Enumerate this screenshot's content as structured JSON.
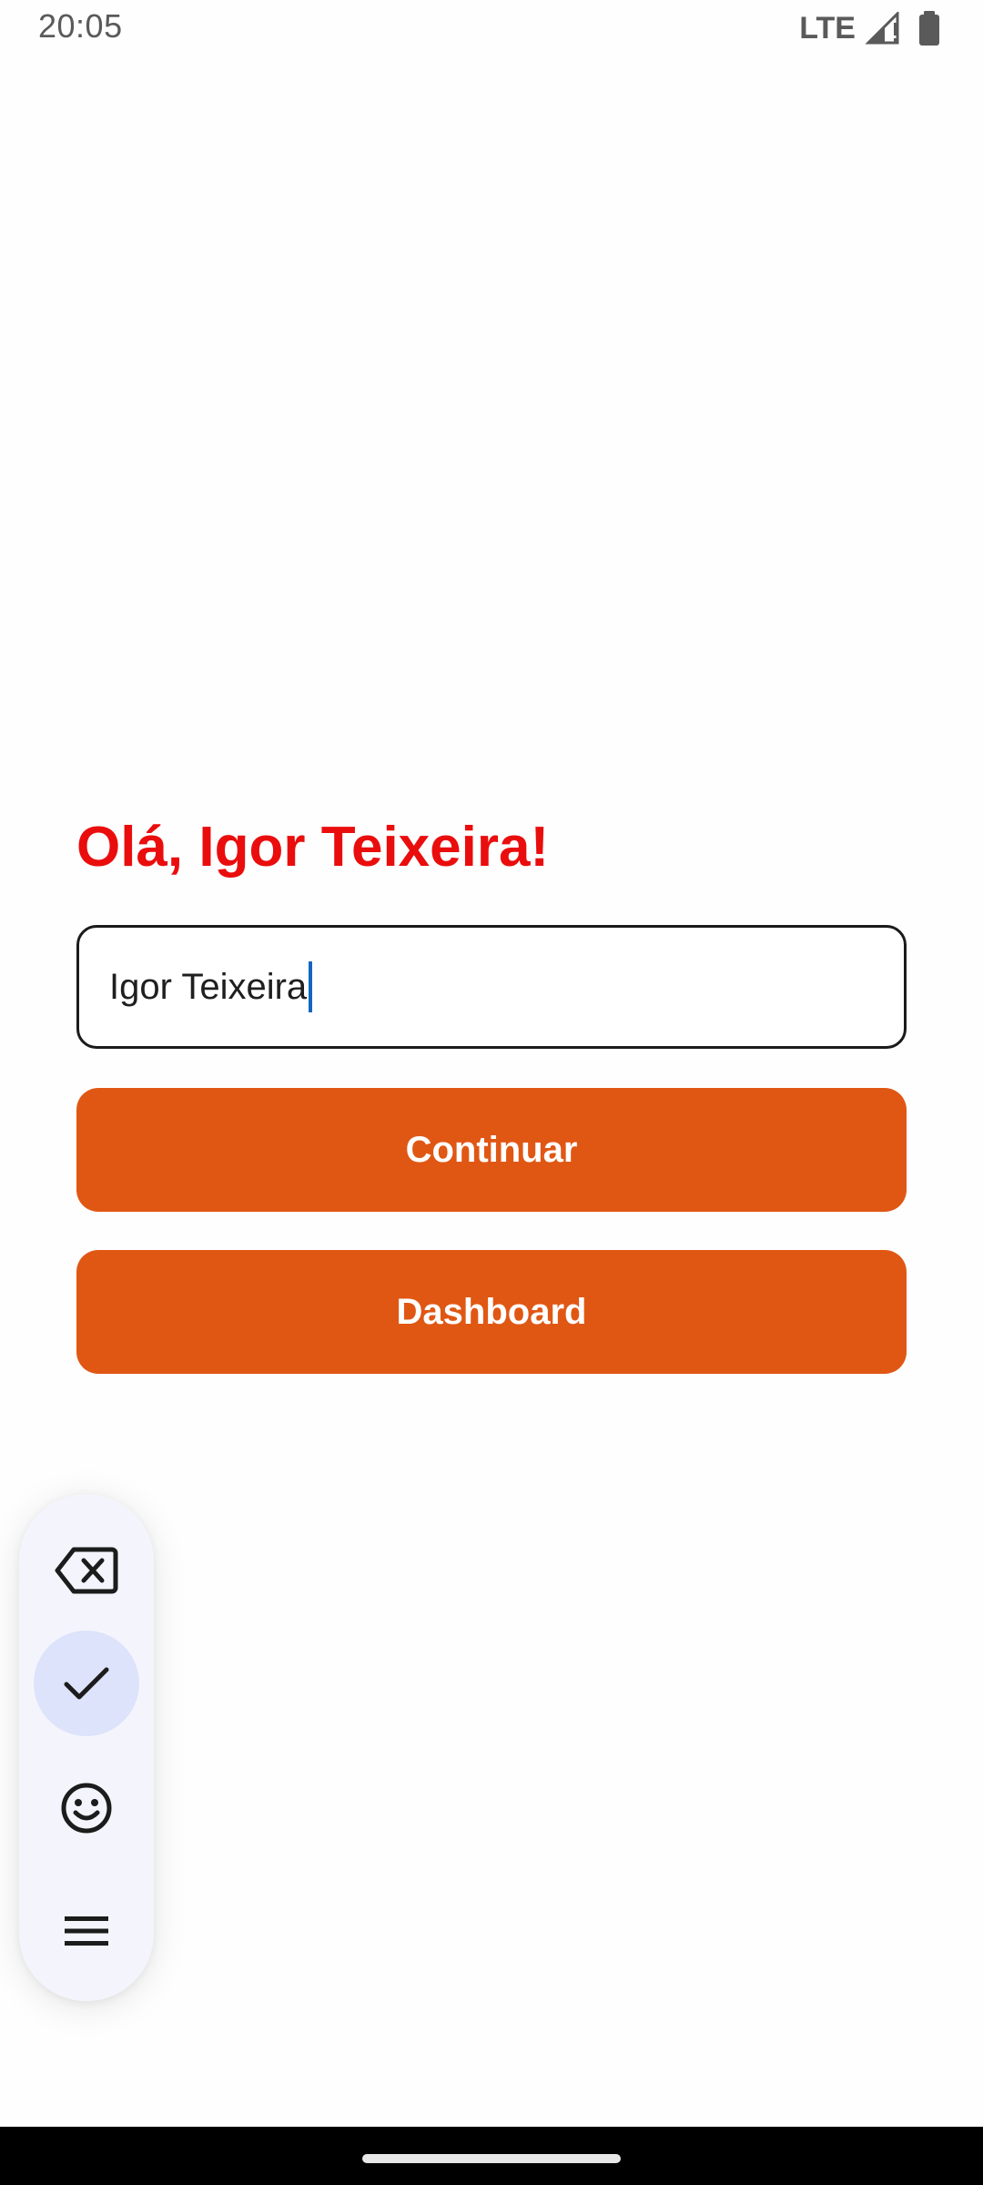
{
  "status_bar": {
    "time": "20:05",
    "network": "LTE",
    "signal_icon": "signal-icon",
    "battery_icon": "battery-icon"
  },
  "greeting": "Olá, Igor Teixeira!",
  "name_input": {
    "value": "Igor Teixeira",
    "placeholder": ""
  },
  "buttons": {
    "continue_label": "Continuar",
    "dashboard_label": "Dashboard"
  },
  "keyboard_toolbar": {
    "items": [
      "backspace-icon",
      "check-icon",
      "emoji-icon",
      "menu-icon"
    ]
  },
  "colors": {
    "greeting": "#ea0d0d",
    "button": "#e05714",
    "cursor": "#1565c0",
    "toolbar_bg": "#f4f5fc",
    "toolbar_selected": "#dde3fa"
  }
}
